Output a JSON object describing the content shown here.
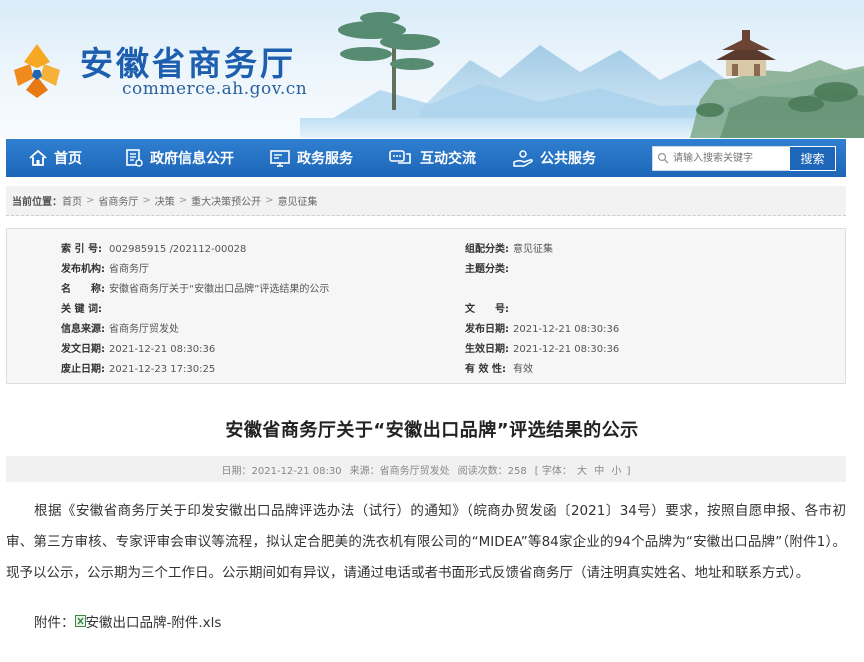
{
  "header": {
    "site_title": "安徽省商务厅",
    "site_domain": "commerce.ah.gov.cn"
  },
  "nav": {
    "items": [
      {
        "label": "首页",
        "icon": "home-icon"
      },
      {
        "label": "政府信息公开",
        "icon": "document-icon"
      },
      {
        "label": "政务服务",
        "icon": "monitor-icon"
      },
      {
        "label": "互动交流",
        "icon": "chat-icon"
      },
      {
        "label": "公共服务",
        "icon": "hand-service-icon"
      }
    ],
    "search_placeholder": "请输入搜索关键字",
    "search_button": "搜索"
  },
  "breadcrumb": {
    "label": "当前位置：",
    "items": [
      "首页",
      "省商务厅",
      "决策",
      "重大决策预公开",
      "意见征集"
    ],
    "separator": ">"
  },
  "meta": {
    "index_no_label": "索 引 号:",
    "index_no": "002985915 /202112-00028",
    "category_label": "组配分类:",
    "category": "意见征集",
    "publisher_label": "发布机构:",
    "publisher": "省商务厅",
    "topic_label": "主题分类:",
    "topic": "",
    "name_label": "名　　称:",
    "name": "安徽省商务厅关于“安徽出口品牌”评选结果的公示",
    "keywords_label": "关 键 词:",
    "keywords": "",
    "doc_no_label": "文　　号:",
    "doc_no": "",
    "source_label": "信息来源:",
    "source": "省商务厅贸发处",
    "publish_date_label": "发布日期:",
    "publish_date": "2021-12-21 08:30:36",
    "issue_date_label": "发文日期:",
    "issue_date": "2021-12-21 08:30:36",
    "effective_date_label": "生效日期:",
    "effective_date": "2021-12-21 08:30:36",
    "expiry_date_label": "废止日期:",
    "expiry_date": "2021-12-23 17:30:25",
    "validity_label": "有 效 性:",
    "validity": "有效"
  },
  "article": {
    "title": "安徽省商务厅关于“安徽出口品牌”评选结果的公示",
    "date": "日期：2021-12-21 08:30",
    "source": "来源：省商务厅贸发处",
    "views": "阅读次数：258",
    "font_label": "[ 字体：",
    "font_large": "大",
    "font_medium": "中",
    "font_small": "小",
    "font_end": "]",
    "body": "根据《安徽省商务厅关于印发安徽出口品牌评选办法（试行）的通知》（皖商办贸发函〔2021〕34号）要求，按照自愿申报、各市初审、第三方审核、专家评审会审议等流程，拟认定合肥美的洗衣机有限公司的“MIDEA”等84家企业的94个品牌为“安徽出口品牌”（附件1）。现予以公示，公示期为三个工作日。公示期间如有异议，请通过电话或者书面形式反馈省商务厅（请注明真实姓名、地址和联系方式）。",
    "attach_label": "附件：",
    "attach_file": "安徽出口品牌-附件.xls"
  },
  "colors": {
    "brand_blue": "#1d66b8",
    "title_blue": "#1d5fae",
    "logo_orange": "#f39a1e"
  }
}
